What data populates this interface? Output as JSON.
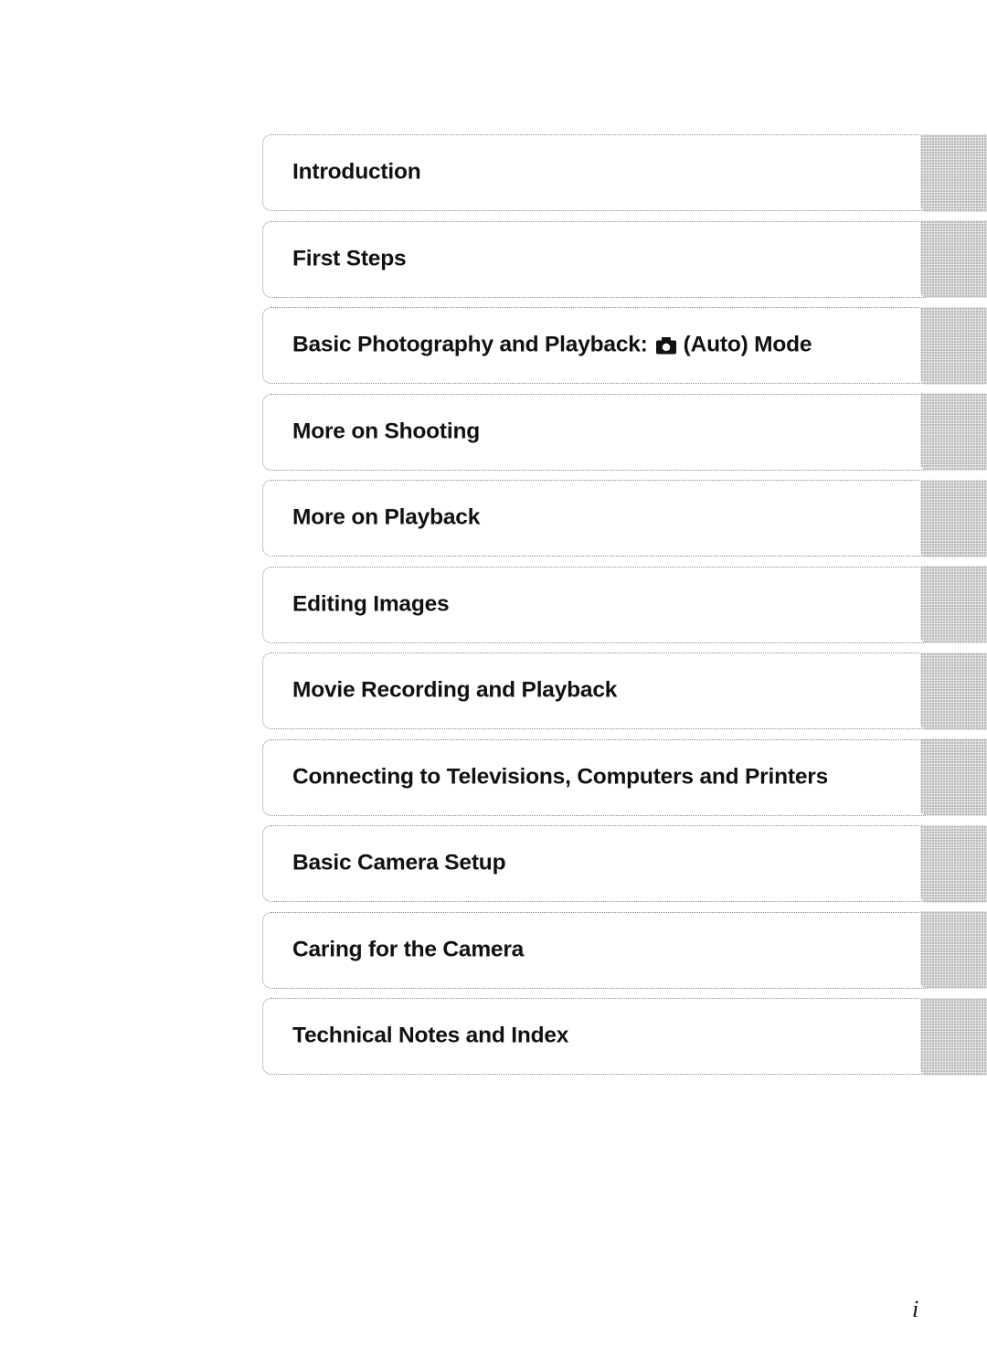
{
  "toc": {
    "items": [
      {
        "label": "Introduction"
      },
      {
        "label": "First Steps"
      },
      {
        "label_before": "Basic Photography and Playback:",
        "icon": "camera-auto-mode-icon",
        "label_after": "(Auto) Mode"
      },
      {
        "label": "More on Shooting"
      },
      {
        "label": "More on Playback"
      },
      {
        "label": "Editing Images"
      },
      {
        "label": "Movie Recording and Playback"
      },
      {
        "label": "Connecting to Televisions, Computers and Printers"
      },
      {
        "label": "Basic Camera Setup"
      },
      {
        "label": "Caring for the Camera"
      },
      {
        "label": "Technical Notes and Index"
      }
    ]
  },
  "page_number": "i"
}
